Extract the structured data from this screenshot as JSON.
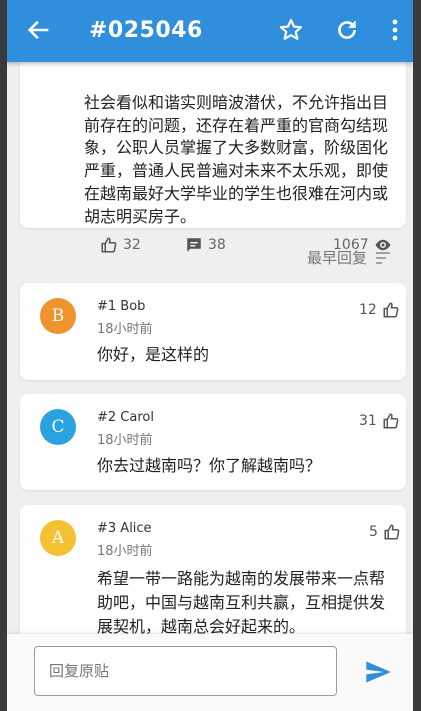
{
  "header": {
    "title": "#025046",
    "back_icon": "arrow-left-icon",
    "star_icon": "star-outline-icon",
    "refresh_icon": "refresh-icon",
    "more_icon": "more-vertical-icon",
    "color": "#2f8fdc"
  },
  "post": {
    "text": "社会看似和谐实则暗波潜伏，不允许指出目前存在的问题，还存在着严重的官商勾结现象，公职人员掌握了大多数财富，阶级固化严重，普通人民普遍对未来不太乐观，即使在越南最好大学毕业的学生也很难在河内或胡志明买房子。",
    "likes": "32",
    "comments": "38",
    "views": "1067"
  },
  "sort": {
    "label": "最早回复"
  },
  "comments": [
    {
      "avatar_letter": "B",
      "avatar_color": "#f0922e",
      "name": "#1 Bob",
      "time": "18小时前",
      "likes": "12",
      "text": "你好，是这样的"
    },
    {
      "avatar_letter": "C",
      "avatar_color": "#2aa2e0",
      "name": "#2 Carol",
      "time": "18小时前",
      "likes": "31",
      "text": "你去过越南吗？你了解越南吗？"
    },
    {
      "avatar_letter": "A",
      "avatar_color": "#f5c032",
      "name": "#3 Alice",
      "time": "18小时前",
      "likes": "5",
      "text": "希望一带一路能为越南的发展带来一点帮助吧，中国与越南互利共赢，互相提供发展契机，越南总会好起来的。"
    }
  ],
  "reply": {
    "placeholder": "回复原贴",
    "send_icon": "send-icon"
  }
}
